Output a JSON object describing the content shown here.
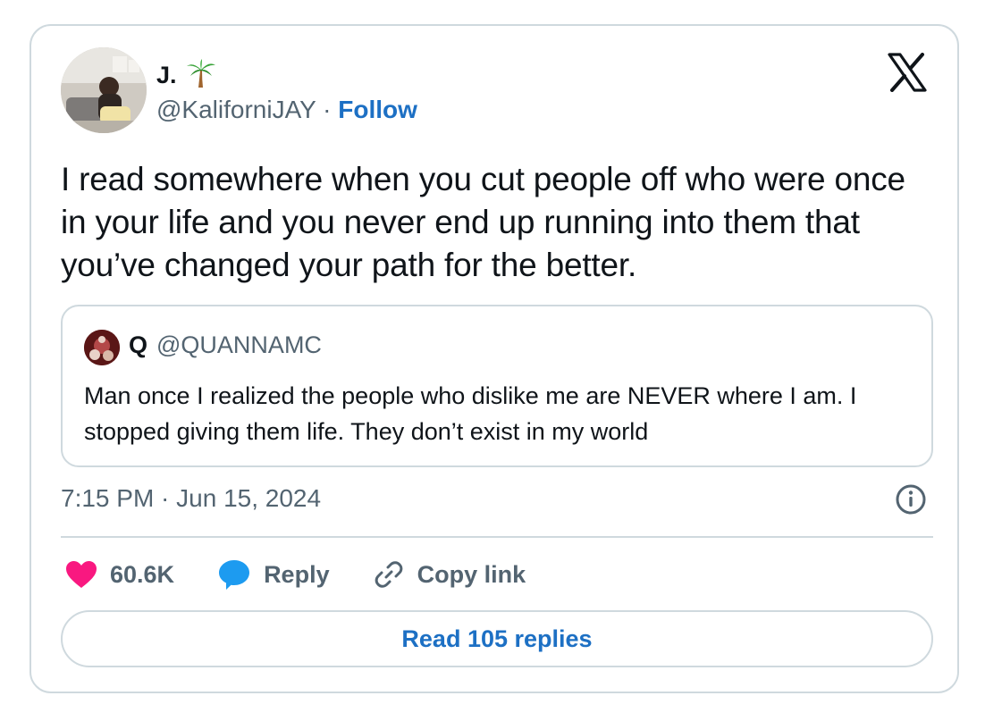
{
  "author": {
    "name": "J.",
    "emoji": "🌴",
    "handle": "@KaliforniJAY",
    "separator": "·",
    "follow_label": "Follow"
  },
  "tweet": {
    "text": "I read somewhere when you cut people off who were once in your life and you never end up running into them that you’ve changed your path for the better."
  },
  "quoted_tweet": {
    "name": "Q",
    "handle": "@QUANNAMC",
    "text": "Man once I realized the people who dislike me are NEVER where I am. I stopped giving them life. They don’t exist in my world"
  },
  "timestamp": "7:15 PM · Jun 15, 2024",
  "actions": {
    "likes": "60.6K",
    "reply_label": "Reply",
    "copy_link_label": "Copy link"
  },
  "read_replies_label": "Read 105 replies",
  "colors": {
    "link_blue": "#1d70c4",
    "like_pink": "#f91880",
    "reply_blue": "#1d9bf0",
    "border": "#cfd9de",
    "muted": "#536471"
  },
  "icons": {
    "brand": "x-logo-icon",
    "info": "info-icon",
    "like": "heart-icon",
    "reply": "speech-bubble-icon",
    "copy": "link-icon"
  }
}
